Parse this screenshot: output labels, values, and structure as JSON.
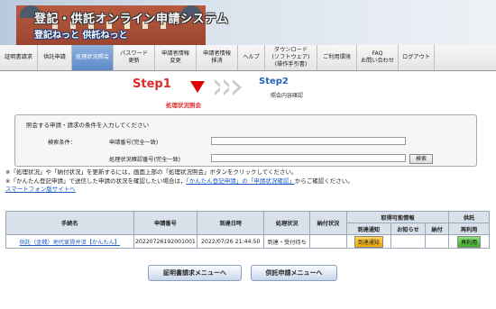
{
  "header": {
    "title": "登記・供託オンライン申請システム",
    "subtitle": "登記ねっと 供託ねっと"
  },
  "nav": [
    {
      "label": "証明書請求"
    },
    {
      "label": "供託申請"
    },
    {
      "label": "処理状況照会",
      "active": true
    },
    {
      "label": "パスワード\n更新"
    },
    {
      "label": "申請者情報\n変更"
    },
    {
      "label": "申請者情報\n抹消"
    },
    {
      "label": "ヘルプ"
    },
    {
      "label": "ダウンロード\n(ソフトウェア)\n(操作手引書)"
    },
    {
      "label": "ご利用環境"
    },
    {
      "label": "FAQ\nお問い合わせ"
    },
    {
      "label": "ログアウト"
    }
  ],
  "steps": {
    "step1": "Step1",
    "step1_sub": "処理状況照会",
    "step2": "Step2",
    "step2_sub": "照会内容確認"
  },
  "conditions": {
    "intro": "照会する申請・請求の条件を入力してください",
    "label": "検索条件：",
    "field1": "申請番号(完全一致)",
    "field2": "処理状況確認番号(完全一致)",
    "search": "検索"
  },
  "notes": {
    "line1": "※「処理状況」や「納付状況」を更新するには，画面上部の「処理状況照会」ボタンをクリックしてください。",
    "line2_pre": "※「かんたん登記申請」で送信した申請の状況を確認したい場合は，",
    "line2_link1": "「かんたん登記申請」の「申請状況確認」",
    "line2_post": "からご確認ください。",
    "line3": "スマートフォン版サイトへ"
  },
  "table": {
    "headers": {
      "name": "手続名",
      "number": "申請番号",
      "arrival": "到達日時",
      "status": "処理状況",
      "payment": "納付状況",
      "available": "取得可能情報",
      "deposit": "供託"
    },
    "subheaders": {
      "arrival_notice": "到達通知",
      "notice": "お知らせ",
      "payment": "納付",
      "reuse": "再利用"
    },
    "rows": [
      {
        "name": "供託（金銭）地代家賃弁済【かんたん】",
        "number": "20220726192001001",
        "arrival": "2022/07/26 21:44:50",
        "status": "到達・受付待ち",
        "payment": "",
        "arrival_btn": "到達通知",
        "reuse_btn": "再利用"
      }
    ]
  },
  "buttons": {
    "cert": "証明書請求メニューへ",
    "deposit": "供託申請メニューへ"
  },
  "colors": {
    "accent_red": "#e02a2a",
    "step2_blue": "#2a63b5",
    "nav_active": "#5c89c6"
  }
}
